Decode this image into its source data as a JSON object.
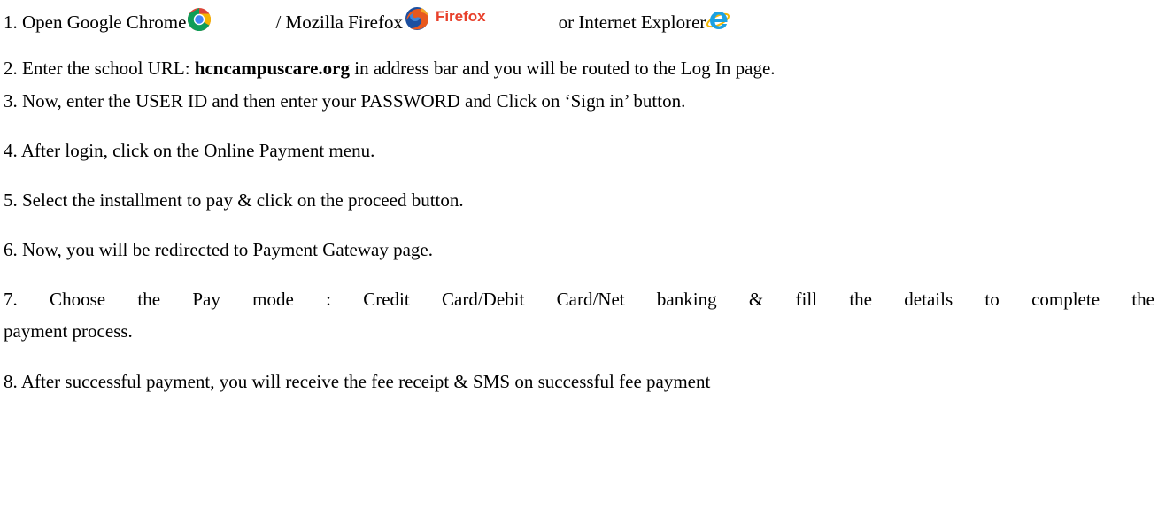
{
  "colors": {
    "text": "#000000",
    "firefox_wordmark": "#e8402b",
    "ie_blue": "#1ba1e2"
  },
  "icons": {
    "chrome": "chrome-logo-icon",
    "firefox": "firefox-logo-icon",
    "ie": "internet-explorer-logo-icon"
  },
  "steps": {
    "s1": {
      "a": "1. Open Google Chrome",
      "b": "/ Mozilla Firefox",
      "firefox_word": "Firefox",
      "c": "or Internet Explorer"
    },
    "s2": {
      "a": "2. Enter the school URL: ",
      "url": "hcncampuscare.org",
      "b": " in address bar and you will be routed to the Log In page."
    },
    "s3": "3. Now, enter the USER ID and then enter your PASSWORD and Click on ‘Sign in’ button.",
    "s4": "4. After login, click on the Online Payment menu.",
    "s5": "5. Select the installment to pay & click on the proceed button.",
    "s6": "6. Now, you will be redirected to Payment Gateway page.",
    "s7": {
      "line1": "7. Choose the Pay mode : Credit Card/Debit Card/Net banking & fill the details to complete the",
      "line2": "payment process."
    },
    "s8": "8. After successful payment, you will receive the fee receipt & SMS on successful fee payment"
  }
}
